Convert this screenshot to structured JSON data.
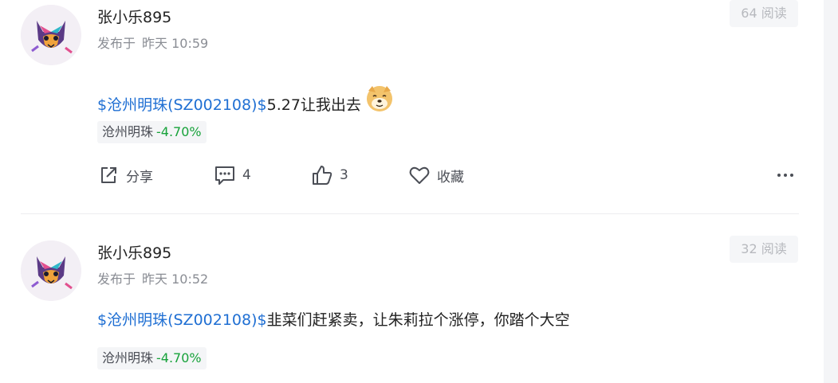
{
  "posts": [
    {
      "username": "张小乐895",
      "published_prefix": "发布于",
      "published_time": "昨天 10:59",
      "read_count": "64 阅读",
      "content": {
        "stock_link": "$沧州明珠(SZ002108)$",
        "text": "5.27让我出去",
        "emoji": "dog-emoji"
      },
      "stock_tag": {
        "name": "沧州明珠",
        "change": "-4.70%"
      },
      "actions": {
        "share_label": "分享",
        "comment_count": "4",
        "like_count": "3",
        "favorite_label": "收藏"
      }
    },
    {
      "username": "张小乐895",
      "published_prefix": "发布于",
      "published_time": "昨天 10:52",
      "read_count": "32 阅读",
      "content": {
        "stock_link": "$沧州明珠(SZ002108)$",
        "text": "韭菜们赶紧卖，让朱莉拉个涨停，你踏个大空"
      },
      "stock_tag": {
        "name": "沧州明珠",
        "change": "-4.70%"
      }
    }
  ],
  "colors": {
    "link": "#1f6fd3",
    "down_change": "#17a23a",
    "muted": "#8a8d94"
  },
  "icons": [
    "share-icon",
    "comment-icon",
    "thumbs-up-icon",
    "heart-icon",
    "more-icon"
  ]
}
